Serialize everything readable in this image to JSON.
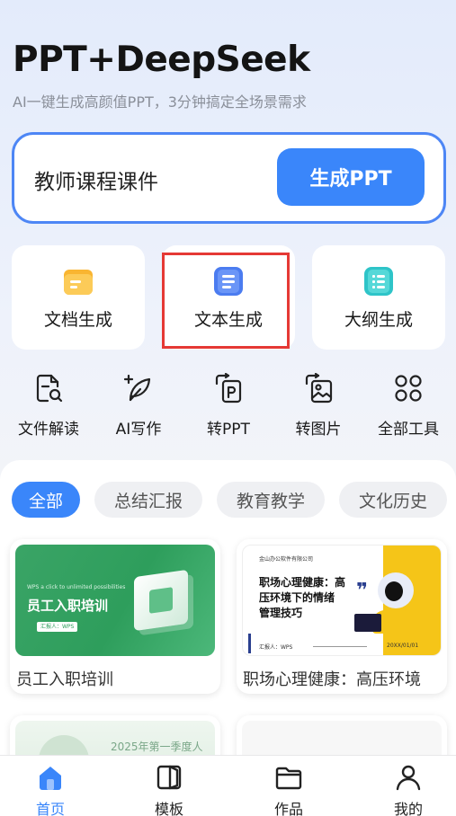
{
  "header": {
    "title": "PPT+DeepSeek",
    "subtitle": "AI一键生成高颜值PPT，3分钟搞定全场景需求"
  },
  "search": {
    "value": "教师课程课件",
    "button_label": "生成PPT"
  },
  "features": [
    {
      "label": "文档生成",
      "icon": "document-folder-icon"
    },
    {
      "label": "文本生成",
      "icon": "text-doc-icon"
    },
    {
      "label": "大纲生成",
      "icon": "outline-list-icon"
    }
  ],
  "tools": [
    {
      "label": "文件解读",
      "icon": "file-search-icon"
    },
    {
      "label": "AI写作",
      "icon": "feather-pen-icon"
    },
    {
      "label": "转PPT",
      "icon": "convert-ppt-icon"
    },
    {
      "label": "转图片",
      "icon": "convert-image-icon"
    },
    {
      "label": "全部工具",
      "icon": "all-tools-icon"
    }
  ],
  "categories": [
    "全部",
    "总结汇报",
    "教育教学",
    "文化历史"
  ],
  "templates": [
    {
      "title": "员工入职培训",
      "thumb_kicker": "WPS a click to unlimited possibilities",
      "thumb_title": "员工入职培训",
      "thumb_reporter": "汇报人：WPS"
    },
    {
      "title": "职场心理健康：高压环境",
      "thumb_company": "金山办公软件有限公司",
      "thumb_title_line1": "职场心理健康：高",
      "thumb_title_line2": "压环境下的情绪",
      "thumb_title_line3": "管理技巧",
      "thumb_reporter": "汇报人：WPS",
      "thumb_date": "20XX/01/01"
    }
  ],
  "partial_templates": [
    {
      "thumb_text": "2025年第一季度人"
    }
  ],
  "tabbar": [
    {
      "label": "首页",
      "icon": "home-icon",
      "active": true
    },
    {
      "label": "模板",
      "icon": "template-book-icon"
    },
    {
      "label": "作品",
      "icon": "folder-icon"
    },
    {
      "label": "我的",
      "icon": "profile-icon"
    }
  ],
  "colors": {
    "accent": "#3a86fa",
    "highlight_border": "#e53935",
    "green_template": "#2e9e5c",
    "yellow_template": "#f5c518"
  }
}
